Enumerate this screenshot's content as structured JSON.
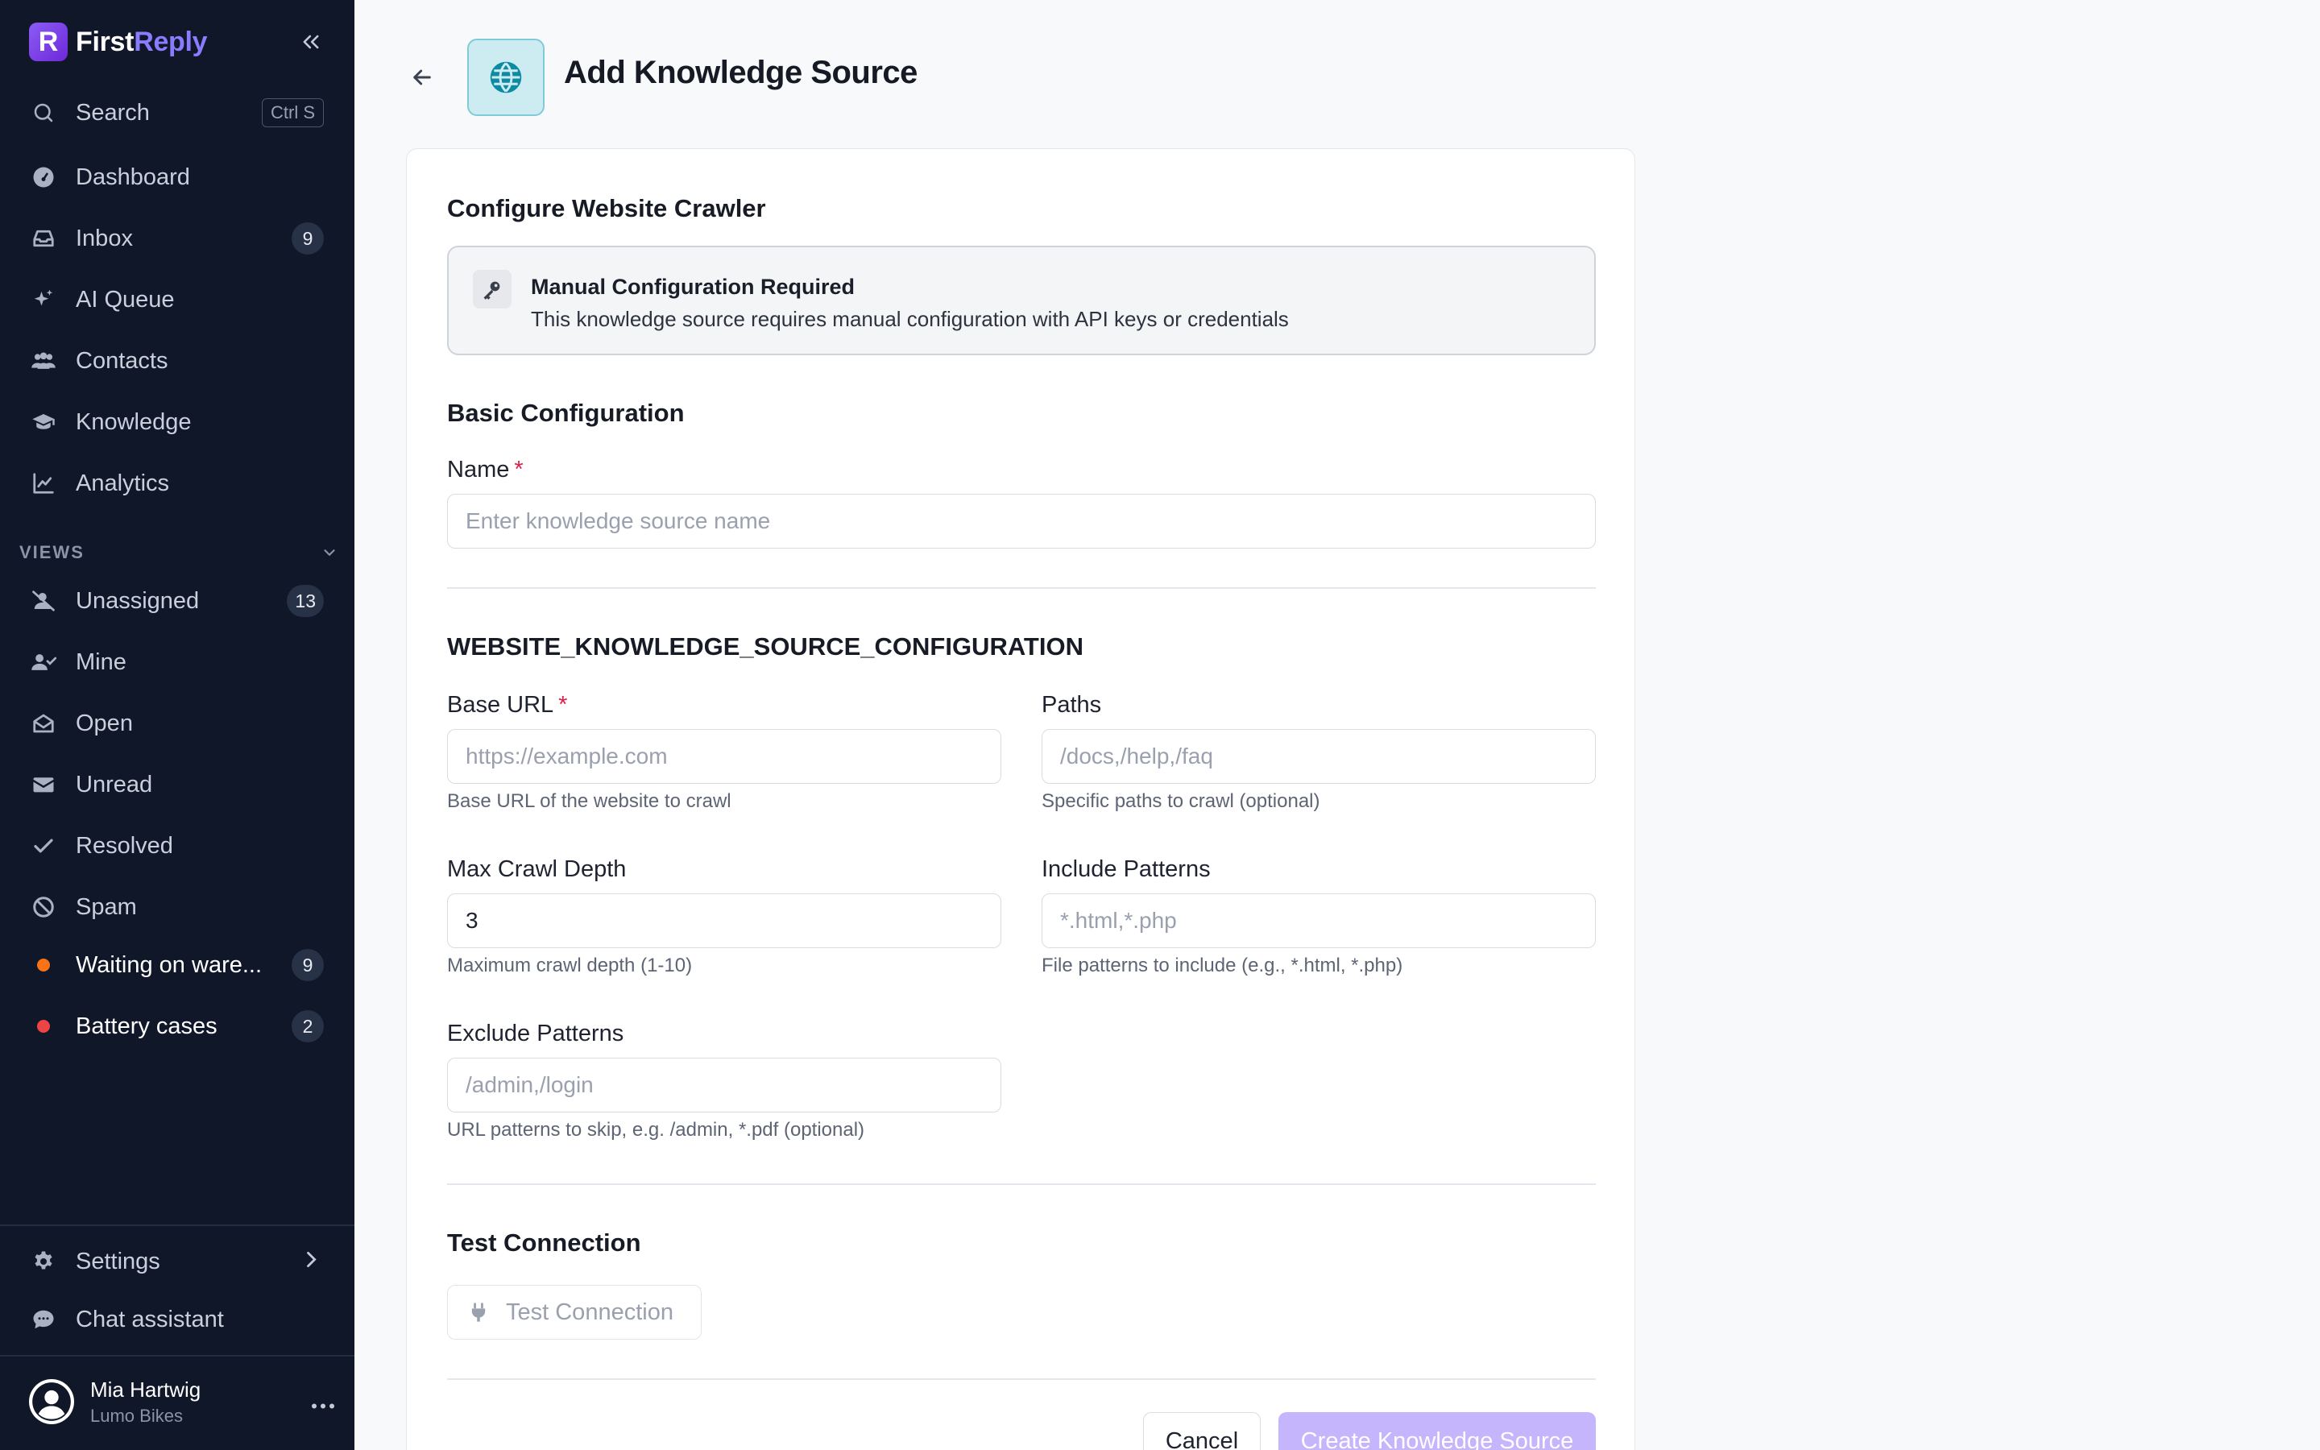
{
  "brand": {
    "mark": "R",
    "first": "First",
    "second": "Reply"
  },
  "sidebar": {
    "search": {
      "label": "Search",
      "shortcut": "Ctrl S"
    },
    "nav": [
      {
        "label": "Dashboard",
        "icon": "dashboard-icon"
      },
      {
        "label": "Inbox",
        "icon": "inbox-icon",
        "badge": "9"
      },
      {
        "label": "AI Queue",
        "icon": "sparkles-icon"
      },
      {
        "label": "Contacts",
        "icon": "users-icon"
      },
      {
        "label": "Knowledge",
        "icon": "graduation-cap-icon"
      },
      {
        "label": "Analytics",
        "icon": "chart-line-icon"
      }
    ],
    "views_title": "VIEWS",
    "views": [
      {
        "label": "Unassigned",
        "icon": "user-slash-icon",
        "badge": "13"
      },
      {
        "label": "Mine",
        "icon": "user-check-icon"
      },
      {
        "label": "Open",
        "icon": "envelope-open-icon"
      },
      {
        "label": "Unread",
        "icon": "envelope-icon"
      },
      {
        "label": "Resolved",
        "icon": "check-icon"
      },
      {
        "label": "Spam",
        "icon": "ban-icon"
      },
      {
        "label": "Waiting on ware...",
        "dot_color": "#f97316",
        "badge": "9"
      },
      {
        "label": "Battery cases",
        "dot_color": "#ef4444",
        "badge": "2"
      }
    ],
    "settings": "Settings",
    "chat_assistant": "Chat assistant",
    "user": {
      "name": "Mia Hartwig",
      "org": "Lumo Bikes"
    }
  },
  "page": {
    "title": "Add Knowledge Source",
    "icon": "globe-icon"
  },
  "form": {
    "section_title": "Configure Website Crawler",
    "notice": {
      "title": "Manual Configuration Required",
      "description": "This knowledge source requires manual configuration with API keys or credentials"
    },
    "basic_title": "Basic Configuration",
    "name": {
      "label": "Name",
      "required": "*",
      "placeholder": "Enter knowledge source name",
      "value": ""
    },
    "config_title": "WEBSITE_KNOWLEDGE_SOURCE_CONFIGURATION",
    "base_url": {
      "label": "Base URL",
      "required": "*",
      "placeholder": "https://example.com",
      "help": "Base URL of the website to crawl"
    },
    "paths": {
      "label": "Paths",
      "placeholder": "/docs,/help,/faq",
      "help": "Specific paths to crawl (optional)"
    },
    "max_depth": {
      "label": "Max Crawl Depth",
      "value": "3",
      "help": "Maximum crawl depth (1-10)"
    },
    "include": {
      "label": "Include Patterns",
      "placeholder": "*.html,*.php",
      "help": "File patterns to include (e.g., *.html, *.php)"
    },
    "exclude": {
      "label": "Exclude Patterns",
      "placeholder": "/admin,/login",
      "help": "URL patterns to skip, e.g. /admin, *.pdf (optional)"
    },
    "test_title": "Test Connection",
    "test_button": "Test Connection",
    "cancel": "Cancel",
    "create": "Create Knowledge Source"
  },
  "colors": {
    "sidebar_bg": "#0f1729",
    "accent": "#8b5cf6",
    "create_disabled": "#c4b5fd",
    "required": "#e11d48"
  }
}
